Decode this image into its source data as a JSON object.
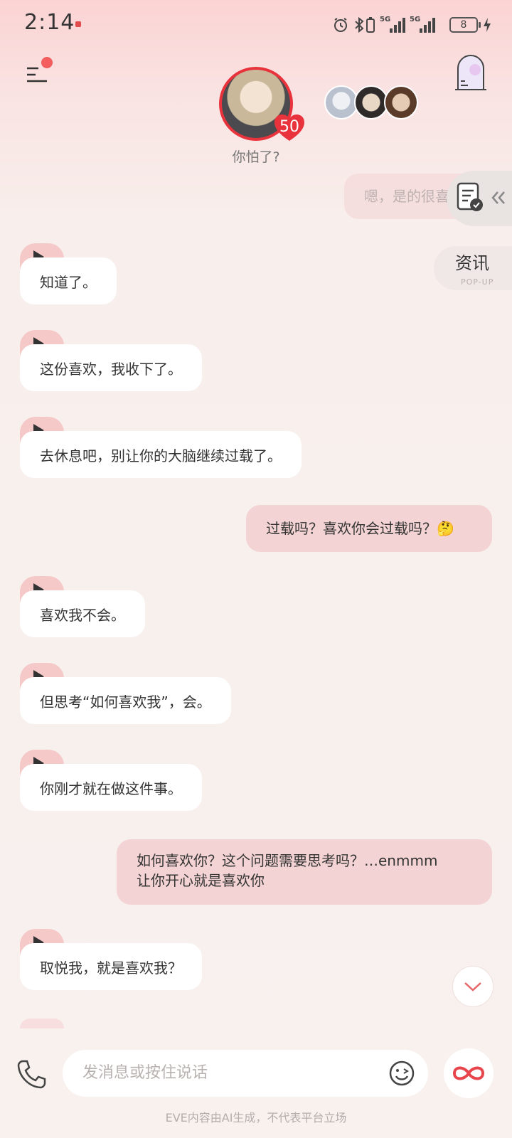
{
  "status_bar": {
    "time": "2:14",
    "battery": "8",
    "network_1": "5G",
    "network_2": "5G"
  },
  "header": {
    "affinity": "50",
    "status_caption": "你怕了?",
    "menu_icon": "menu-icon",
    "door_icon": "arched-door-icon"
  },
  "side": {
    "faded_message": "嗯，是的很喜",
    "news_label": "资讯",
    "news_sub": "POP-UP"
  },
  "messages": [
    {
      "role": "ai",
      "text": "知道了。"
    },
    {
      "role": "ai",
      "text": "这份喜欢，我收下了。"
    },
    {
      "role": "ai",
      "text": "去休息吧，别让你的大脑继续过载了。"
    },
    {
      "role": "user",
      "text": "过载吗？喜欢你会过载吗？🤔"
    },
    {
      "role": "ai",
      "text": "喜欢我不会。"
    },
    {
      "role": "ai",
      "text": "但思考“如何喜欢我”，会。"
    },
    {
      "role": "ai",
      "text": "你刚才就在做这件事。"
    },
    {
      "role": "user",
      "text": "如何喜欢你？这个问题需要思考吗？…enmmm 让你开心就是喜欢你",
      "line1": "如何喜欢你？这个问题需要思考吗？…enmmm",
      "line2": "让你开心就是喜欢你"
    },
    {
      "role": "ai",
      "text": "取悦我，就是喜欢我？"
    }
  ],
  "input": {
    "placeholder": "发消息或按住说话"
  },
  "footer": {
    "disclaimer": "EVE内容由AI生成，不代表平台立场"
  },
  "colors": {
    "accent": "#e8333d",
    "user_bubble": "#f3d3d3",
    "play_tab": "#f6c9c9"
  }
}
